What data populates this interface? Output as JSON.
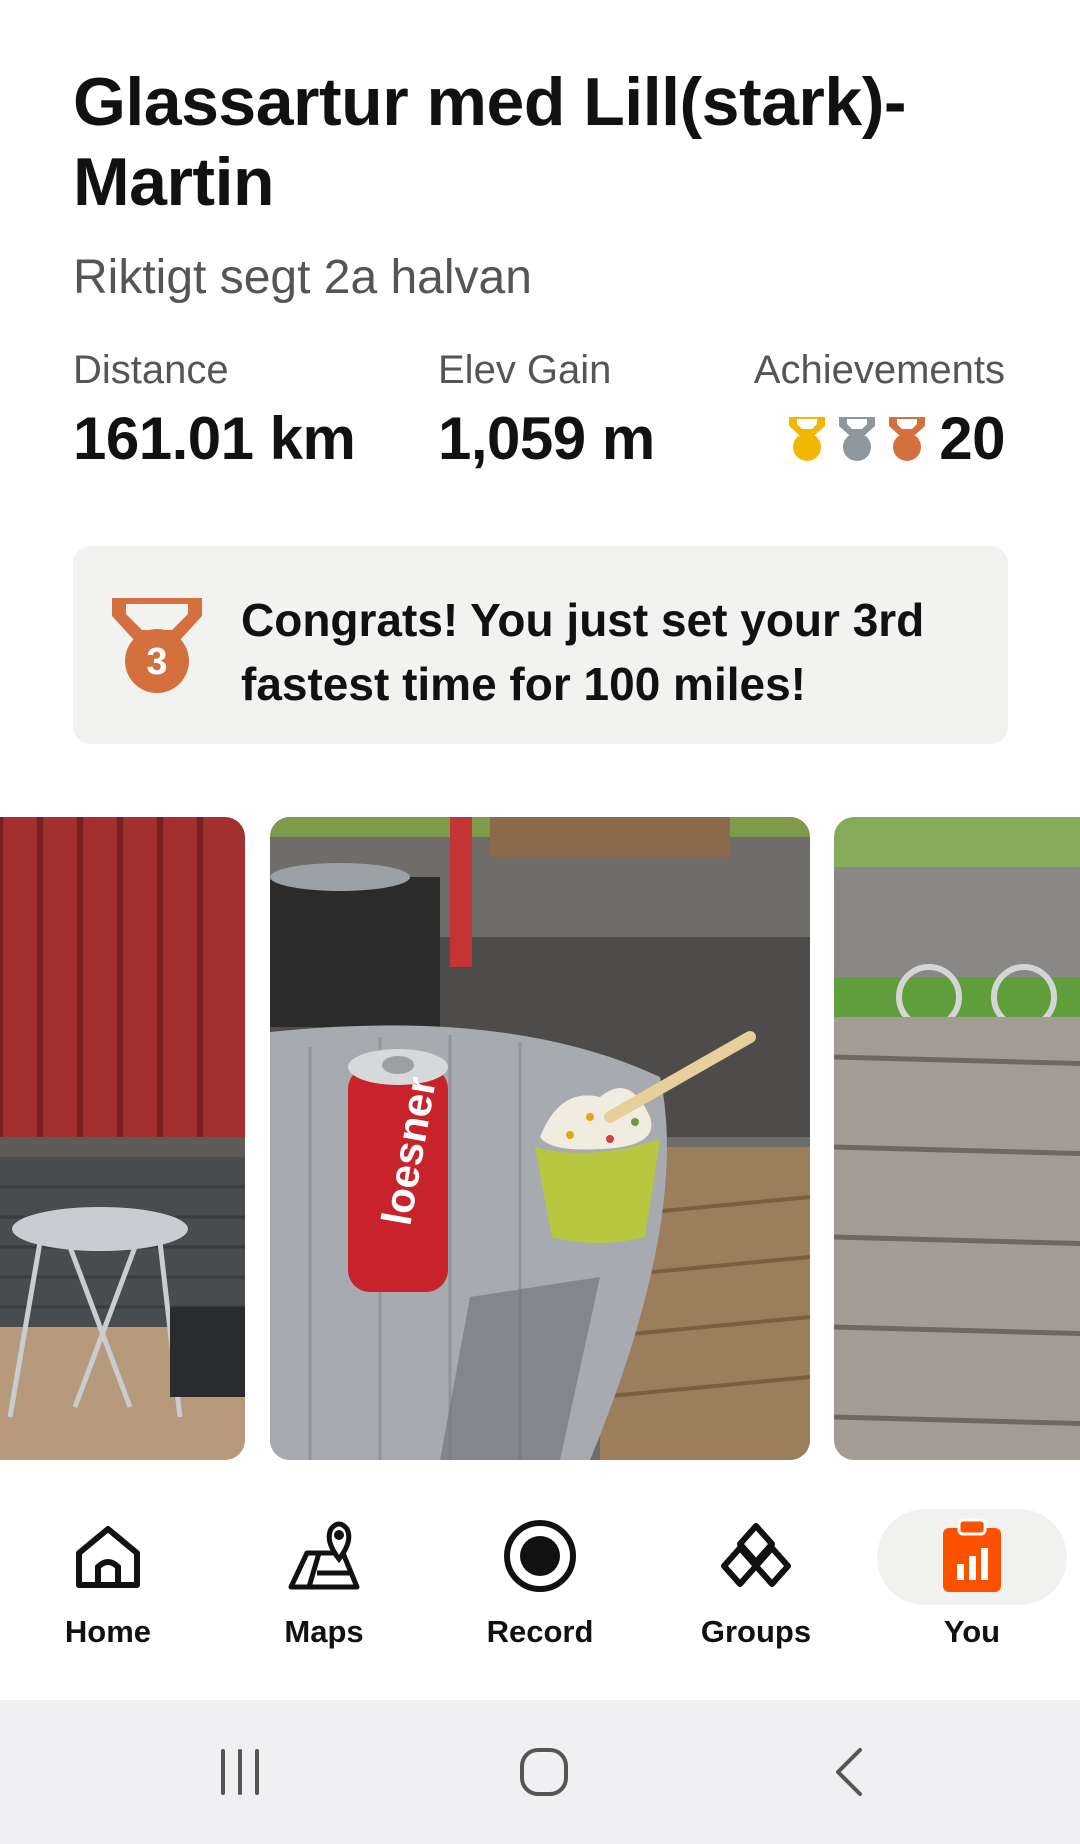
{
  "activity": {
    "title": "Glassartur med Lill(stark)-Martin",
    "description": "Riktigt segt 2a halvan"
  },
  "stats": {
    "distance_label": "Distance",
    "distance_value": "161.01 km",
    "elev_label": "Elev Gain",
    "elev_value": "1,059 m",
    "achievements_label": "Achievements",
    "achievements_count": "20",
    "medal_icons": [
      "gold-medal-icon",
      "silver-medal-icon",
      "bronze-medal-icon"
    ]
  },
  "congrats": {
    "medal_number": "3",
    "message": "Congrats! You just set your 3rd fastest time for 100 miles!"
  },
  "photos": [
    "building-patio-photo",
    "can-and-frozen-yogurt-photo",
    "wooden-deck-bikes-photo"
  ],
  "nav": {
    "items": [
      {
        "label": "Home",
        "icon": "home-icon"
      },
      {
        "label": "Maps",
        "icon": "maps-icon"
      },
      {
        "label": "Record",
        "icon": "record-icon"
      },
      {
        "label": "Groups",
        "icon": "groups-icon"
      },
      {
        "label": "You",
        "icon": "you-icon",
        "active": true
      }
    ]
  },
  "colors": {
    "accent": "#fc5200",
    "gold": "#f2b705",
    "silver": "#8e979b",
    "bronze": "#d4703e"
  }
}
